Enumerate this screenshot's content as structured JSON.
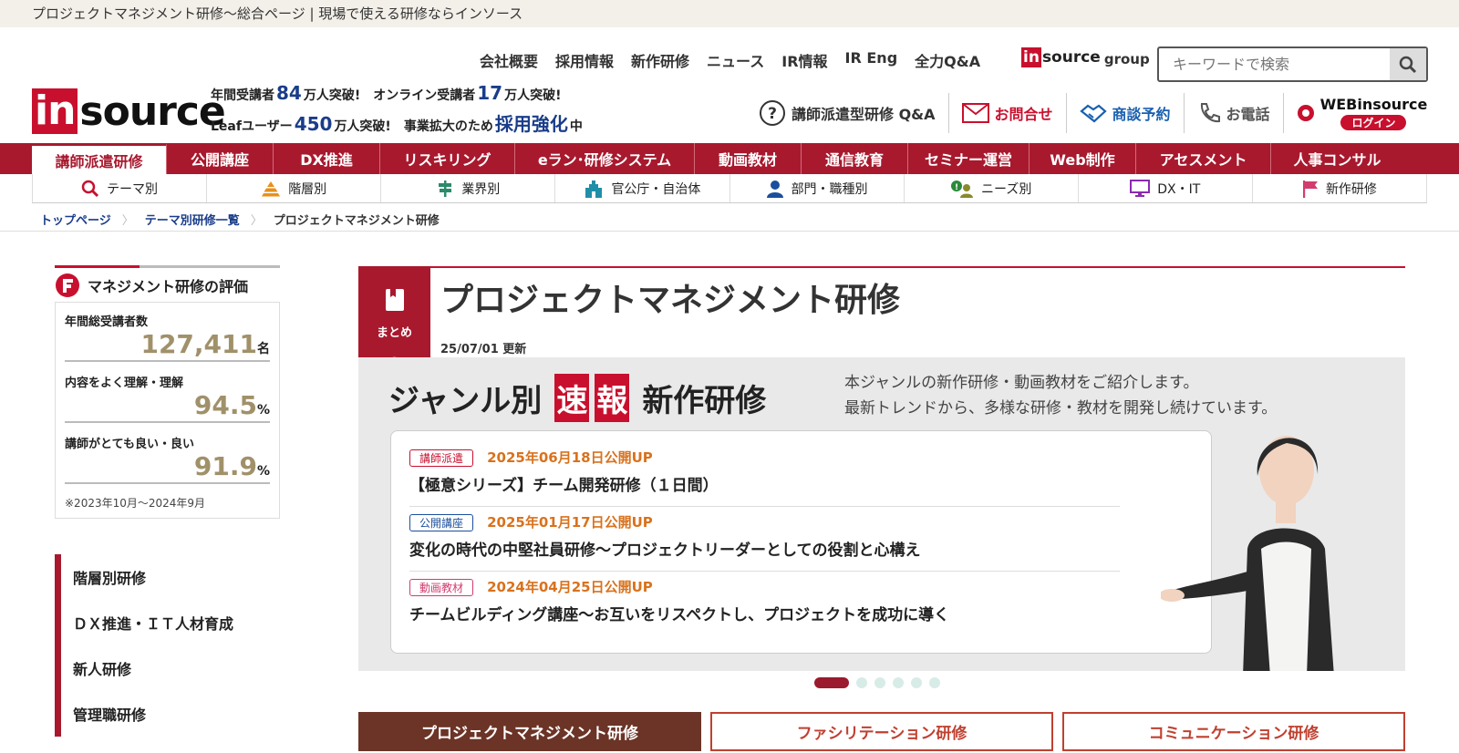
{
  "top_bar": {
    "title": "プロジェクトマネジメント研修～総合ページ | 現場で使える研修ならインソース"
  },
  "top_nav": [
    "会社概要",
    "採用情報",
    "新作研修",
    "ニュース",
    "IR情報",
    "IR Eng",
    "全力Q&A"
  ],
  "group_logo": {
    "in": "in",
    "source": "source",
    "group": "group"
  },
  "search": {
    "placeholder": "キーワードで検索"
  },
  "logo": {
    "in": "in",
    "source": "source"
  },
  "stats": {
    "row1": {
      "l1": "年間受講者",
      "v1": "84",
      "u1": "万人突破!",
      "l2": "オンライン受講者",
      "v2": "17",
      "u2": "万人突破!"
    },
    "row2": {
      "l1": "Leafユーザー",
      "v1": "450",
      "u1": "万人突破!",
      "l2": "事業拡大のため",
      "v2": "採用強化",
      "u2": "中"
    }
  },
  "actions": {
    "qa": "講師派遣型研修 Q&A",
    "contact": "お問合せ",
    "meeting": "商談予約",
    "tel": "お電話",
    "web_title": "WEBinsource",
    "web_login": "ログイン"
  },
  "main_nav": [
    {
      "label": "講師派遣研修",
      "active": true
    },
    {
      "label": "公開講座"
    },
    {
      "label": "DX推進"
    },
    {
      "label": "リスキリング"
    },
    {
      "label": "eラン･研修システム"
    },
    {
      "label": "動画教材"
    },
    {
      "label": "通信教育"
    },
    {
      "label": "セミナー運営"
    },
    {
      "label": "Web制作"
    },
    {
      "label": "アセスメント"
    },
    {
      "label": "人事コンサル"
    }
  ],
  "sub_nav": [
    {
      "label": "テーマ別",
      "icon": "search-icon"
    },
    {
      "label": "階層別",
      "icon": "pyramid-icon"
    },
    {
      "label": "業界別",
      "icon": "signpost-icon"
    },
    {
      "label": "官公庁・自治体",
      "icon": "government-icon"
    },
    {
      "label": "部門・職種別",
      "icon": "person-icon"
    },
    {
      "label": "ニーズ別",
      "icon": "needs-icon"
    },
    {
      "label": "DX・IT",
      "icon": "monitor-icon"
    },
    {
      "label": "新作研修",
      "icon": "flag-icon"
    }
  ],
  "breadcrumb": {
    "home": "トップページ",
    "theme": "テーマ別研修一覧",
    "current": "プロジェクトマネジメント研修"
  },
  "evaluation": {
    "title": "マネジメント研修の評価",
    "items": [
      {
        "label": "年間総受講者数",
        "value": "127,411",
        "unit": "名"
      },
      {
        "label": "内容をよく理解・理解",
        "value": "94.5",
        "unit": "%"
      },
      {
        "label": "講師がとても良い・良い",
        "value": "91.9",
        "unit": "%"
      }
    ],
    "note": "※2023年10月～2024年9月"
  },
  "side_menu": [
    "階層別研修",
    "ＤＸ推進・ＩＴ人材育成",
    "新人研修",
    "管理職研修"
  ],
  "page": {
    "badge": "まとめ",
    "title": "プロジェクトマネジメント研修",
    "updated": "25/07/01 更新"
  },
  "banner": {
    "heading_a": "ジャンル別",
    "heading_b": "速",
    "heading_c": "報",
    "heading_d": "新作研修",
    "desc1": "本ジャンルの新作研修・動画教材をご紹介します。",
    "desc2": "最新トレンドから、多様な研修・教材を開発し続けています。",
    "entries": [
      {
        "tag": "講師派遣",
        "tag_color": "#c8102e",
        "date": "2025年06月18日公開UP",
        "title": "【極意シリーズ】チーム開発研修（１日間）"
      },
      {
        "tag": "公開講座",
        "tag_color": "#1a4f9c",
        "date": "2025年01月17日公開UP",
        "title": "変化の時代の中堅社員研修～プロジェクトリーダーとしての役割と心構え"
      },
      {
        "tag": "動画教材",
        "tag_color": "#d23c6e",
        "date": "2024年04月25日公開UP",
        "title": "チームビルディング講座～お互いをリスペクトし、プロジェクトを成功に導く"
      }
    ]
  },
  "carousel": {
    "total": 6,
    "active": 1
  },
  "tabs": [
    {
      "label": "プロジェクトマネジメント研修",
      "active": true
    },
    {
      "label": "ファシリテーション研修"
    },
    {
      "label": "コミュニケーション研修"
    }
  ],
  "colors": {
    "brand": "#c8102e",
    "nav": "#a8192e",
    "link": "#1a3d8a",
    "gold": "#a0916a"
  }
}
